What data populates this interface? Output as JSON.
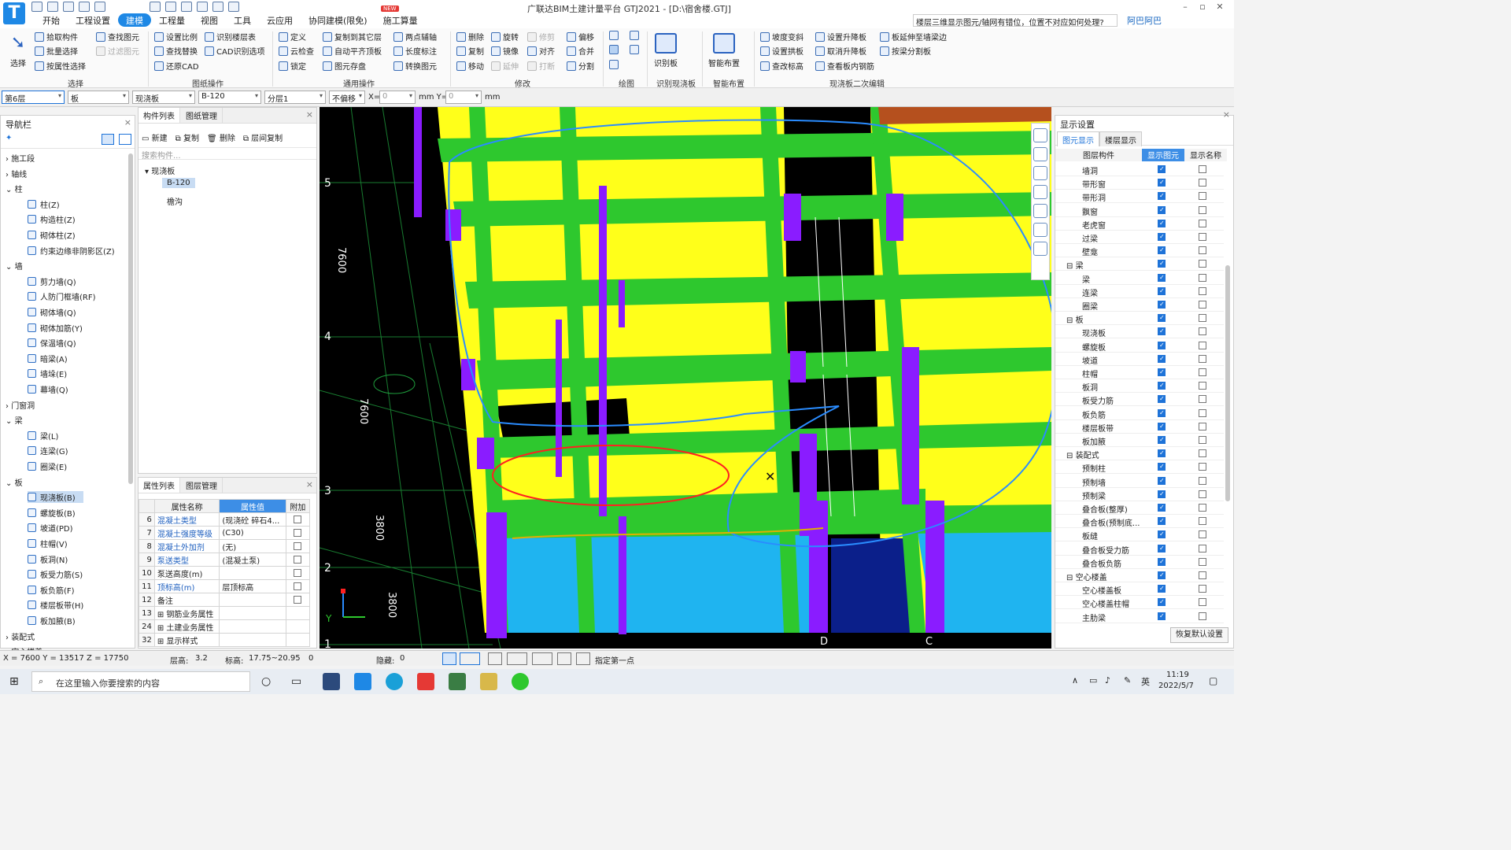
{
  "app": {
    "title": "广联达BIM土建计量平台 GTJ2021 - [D:\\宿舍楼.GTJ]",
    "search_hint": "楼层三维显示图元/轴网有错位，位置不对应如何处理?",
    "user": "阿巴阿巴",
    "new_badge": "NEW"
  },
  "menu_tabs": [
    "开始",
    "工程设置",
    "建模",
    "工程量",
    "视图",
    "工具",
    "云应用",
    "协同建模(限免)",
    "施工算量"
  ],
  "ribbon": {
    "select": {
      "big": "选择",
      "items": [
        "拾取构件",
        "批量选择",
        "按属性选择",
        "查找图元",
        "过滤图元"
      ],
      "group": "选择"
    },
    "drawing_ops": {
      "items": [
        "设置比例",
        "识别楼层表",
        "查找替换",
        "CAD识别选项",
        "还原CAD"
      ],
      "group": "图纸操作"
    },
    "common_ops": {
      "items": [
        "定义",
        "复制到其它层",
        "两点辅轴",
        "云检查",
        "自动平齐顶板",
        "长度标注",
        "锁定",
        "图元存盘",
        "转换图元"
      ],
      "group": "通用操作"
    },
    "modify": {
      "items": [
        "删除",
        "旋转",
        "修剪",
        "偏移",
        "复制",
        "镜像",
        "对齐",
        "合并",
        "移动",
        "延伸",
        "打断",
        "分割"
      ],
      "group": "修改"
    },
    "draw": {
      "group": "绘图"
    },
    "recognize": {
      "big": "识别板",
      "group": "识别现浇板"
    },
    "smart": {
      "big": "智能布置",
      "group": "智能布置"
    },
    "secondary": {
      "items": [
        "坡度变斜",
        "设置升降板",
        "板延伸至墙梁边",
        "设置拱板",
        "取消升降板",
        "按梁分割板",
        "查改标高",
        "查看板内钢筋"
      ],
      "group": "现浇板二次编辑"
    }
  },
  "options_bar": {
    "floor": "第6层",
    "category": "板",
    "type": "现浇板",
    "component": "B-120",
    "layer": "分层1",
    "offset": "不偏移",
    "x_label": "X=",
    "x_value": "0",
    "unit1": "mm Y=",
    "y_value": "0",
    "unit2": "mm"
  },
  "nav": {
    "title": "导航栏",
    "entries": [
      {
        "kind": "cat",
        "text": "施工段"
      },
      {
        "kind": "cat",
        "text": "轴线"
      },
      {
        "kind": "cat",
        "text": "柱"
      },
      {
        "kind": "item",
        "text": "柱(Z)"
      },
      {
        "kind": "item",
        "text": "构造柱(Z)"
      },
      {
        "kind": "item",
        "text": "砌体柱(Z)"
      },
      {
        "kind": "item",
        "text": "约束边缘非阴影区(Z)"
      },
      {
        "kind": "cat",
        "text": "墙"
      },
      {
        "kind": "item",
        "text": "剪力墙(Q)"
      },
      {
        "kind": "item",
        "text": "人防门框墙(RF)"
      },
      {
        "kind": "item",
        "text": "砌体墙(Q)"
      },
      {
        "kind": "item",
        "text": "砌体加筋(Y)"
      },
      {
        "kind": "item",
        "text": "保温墙(Q)"
      },
      {
        "kind": "item",
        "text": "暗梁(A)"
      },
      {
        "kind": "item",
        "text": "墙垛(E)"
      },
      {
        "kind": "item",
        "text": "幕墙(Q)"
      },
      {
        "kind": "cat",
        "text": "门窗洞"
      },
      {
        "kind": "cat",
        "text": "梁"
      },
      {
        "kind": "item",
        "text": "梁(L)"
      },
      {
        "kind": "item",
        "text": "连梁(G)"
      },
      {
        "kind": "item",
        "text": "圈梁(E)"
      },
      {
        "kind": "cat",
        "text": "板"
      },
      {
        "kind": "item",
        "text": "现浇板(B)",
        "selected": true
      },
      {
        "kind": "item",
        "text": "螺旋板(B)"
      },
      {
        "kind": "item",
        "text": "坡道(PD)"
      },
      {
        "kind": "item",
        "text": "柱帽(V)"
      },
      {
        "kind": "item",
        "text": "板洞(N)"
      },
      {
        "kind": "item",
        "text": "板受力筋(S)"
      },
      {
        "kind": "item",
        "text": "板负筋(F)"
      },
      {
        "kind": "item",
        "text": "楼层板带(H)"
      },
      {
        "kind": "item",
        "text": "板加腋(B)"
      },
      {
        "kind": "cat",
        "text": "装配式"
      },
      {
        "kind": "cat",
        "text": "空心楼盖"
      }
    ]
  },
  "component_list": {
    "tabs": [
      "构件列表",
      "图纸管理"
    ],
    "toolbar": [
      "新建",
      "复制",
      "删除",
      "层间复制"
    ],
    "search_placeholder": "搜索构件...",
    "tree": [
      "现浇板",
      "B-120",
      "檐沟"
    ]
  },
  "props": {
    "tabs": [
      "属性列表",
      "图层管理"
    ],
    "headers": [
      "属性名称",
      "属性值",
      "附加"
    ],
    "rows": [
      {
        "no": "6",
        "name": "混凝土类型",
        "value": "(现浇砼 碎石4...",
        "check": true
      },
      {
        "no": "7",
        "name": "混凝土强度等级",
        "value": "(C30)",
        "check": true
      },
      {
        "no": "8",
        "name": "混凝土外加剂",
        "value": "(无)",
        "check": false
      },
      {
        "no": "9",
        "name": "泵送类型",
        "value": "(混凝土泵)",
        "check": false
      },
      {
        "no": "10",
        "name": "泵送高度(m)",
        "value": "",
        "check": false
      },
      {
        "no": "11",
        "name": "顶标高(m)",
        "value": "层顶标高",
        "check": true
      },
      {
        "no": "12",
        "name": "备注",
        "value": "",
        "check": true
      },
      {
        "no": "13",
        "name": "钢筋业务属性",
        "value": "",
        "check": false
      },
      {
        "no": "24",
        "name": "土建业务属性",
        "value": "",
        "check": false
      },
      {
        "no": "32",
        "name": "显示样式",
        "value": "",
        "check": false
      }
    ]
  },
  "viewport": {
    "axis_numbers": [
      "5",
      "4",
      "3",
      "2",
      "1"
    ],
    "dims": [
      "7600",
      "7600",
      "3800",
      "3800"
    ],
    "axis_letters": [
      "D",
      "C"
    ]
  },
  "display": {
    "title": "显示设置",
    "tabs": [
      "图元显示",
      "楼层显示"
    ],
    "headers": [
      "图层构件",
      "显示图元",
      "显示名称"
    ],
    "rows": [
      {
        "t": "墙洞",
        "s": true,
        "n": false
      },
      {
        "t": "带形窗",
        "s": true,
        "n": false
      },
      {
        "t": "带形洞",
        "s": true,
        "n": false
      },
      {
        "t": "飘窗",
        "s": true,
        "n": false
      },
      {
        "t": "老虎窗",
        "s": true,
        "n": false
      },
      {
        "t": "过梁",
        "s": true,
        "n": false
      },
      {
        "t": "壁龛",
        "s": true,
        "n": false
      },
      {
        "t": "梁",
        "s": true,
        "n": false,
        "g": true
      },
      {
        "t": "梁",
        "s": true,
        "n": false
      },
      {
        "t": "连梁",
        "s": true,
        "n": false
      },
      {
        "t": "圈梁",
        "s": true,
        "n": false
      },
      {
        "t": "板",
        "s": true,
        "n": false,
        "g": true
      },
      {
        "t": "现浇板",
        "s": true,
        "n": false
      },
      {
        "t": "螺旋板",
        "s": true,
        "n": false
      },
      {
        "t": "坡道",
        "s": true,
        "n": false
      },
      {
        "t": "柱帽",
        "s": true,
        "n": false
      },
      {
        "t": "板洞",
        "s": true,
        "n": false
      },
      {
        "t": "板受力筋",
        "s": true,
        "n": false
      },
      {
        "t": "板负筋",
        "s": true,
        "n": false
      },
      {
        "t": "楼层板带",
        "s": true,
        "n": false
      },
      {
        "t": "板加腋",
        "s": true,
        "n": false
      },
      {
        "t": "装配式",
        "s": true,
        "n": false,
        "g": true
      },
      {
        "t": "预制柱",
        "s": true,
        "n": false
      },
      {
        "t": "预制墙",
        "s": true,
        "n": false
      },
      {
        "t": "预制梁",
        "s": true,
        "n": false
      },
      {
        "t": "叠合板(整厚)",
        "s": true,
        "n": false
      },
      {
        "t": "叠合板(预制底...",
        "s": true,
        "n": false
      },
      {
        "t": "板缝",
        "s": true,
        "n": false
      },
      {
        "t": "叠合板受力筋",
        "s": true,
        "n": false
      },
      {
        "t": "叠合板负筋",
        "s": true,
        "n": false
      },
      {
        "t": "空心楼盖",
        "s": true,
        "n": false,
        "g": true
      },
      {
        "t": "空心楼盖板",
        "s": true,
        "n": false
      },
      {
        "t": "空心楼盖柱帽",
        "s": true,
        "n": false
      },
      {
        "t": "主肋梁",
        "s": true,
        "n": false
      }
    ],
    "reset": "恢复默认设置"
  },
  "status": {
    "coords": "X = 7600 Y = 13517 Z = 17750",
    "floor_h_label": "层高:",
    "floor_h": "3.2",
    "elev_label": "标高:",
    "elev": "17.75~20.95",
    "zero": "0",
    "hidden_label": "隐藏:",
    "hidden": "0",
    "hint": "指定第一点"
  },
  "taskbar": {
    "search": "在这里输入你要搜索的内容",
    "time": "11:19",
    "date": "2022/5/7",
    "ime": "英"
  },
  "colors": {
    "accent": "#1e88e5",
    "slab": "#ffff1a",
    "beam": "#2ec82e",
    "column": "#8a1cff",
    "wall": "#1fb4f0",
    "annot_red": "#ff2020",
    "annot_blue": "#2a8cff"
  }
}
